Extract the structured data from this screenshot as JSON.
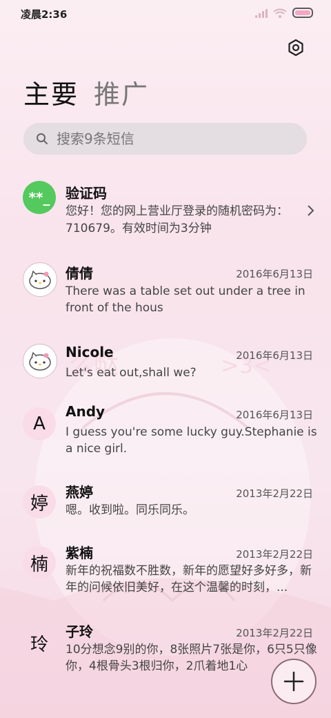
{
  "status_bar": {
    "time": "凌晨2:36"
  },
  "tabs": [
    {
      "label": "主要",
      "active": true
    },
    {
      "label": "推广",
      "active": false
    }
  ],
  "search": {
    "placeholder": "搜索9条短信"
  },
  "messages": [
    {
      "avatar_text": "**_",
      "name": "验证码",
      "date": "",
      "preview": "您好！您的网上营业厅登录的随机密码为：710679。有效时间为3分钟"
    },
    {
      "avatar_icon": "hello-kitty-icon",
      "name": "倩倩",
      "date": "2016年6月13日",
      "preview": "There was a table set out under a tree in front of the hous"
    },
    {
      "avatar_icon": "hello-kitty-icon",
      "name": "Nicole",
      "date": "2016年6月13日",
      "preview": "Let's eat out,shall we?"
    },
    {
      "avatar_text": "A",
      "name": "Andy",
      "date": "2016年6月13日",
      "preview": "I guess you're some lucky guy.Stephanie is a nice girl."
    },
    {
      "avatar_text": "婷",
      "name": "燕婷",
      "date": "2013年2月22日",
      "preview": "嗯。收到啦。同乐同乐。"
    },
    {
      "avatar_text": "楠",
      "name": "紫楠",
      "date": "2013年2月22日",
      "preview": "新年的祝福数不胜数，新年的愿望好多好多，新年的问候依旧美好，在这个温馨的时刻，..."
    },
    {
      "avatar_text": "玲",
      "name": "子玲",
      "date": "2013年2月22日",
      "preview": "10分想念9别的你，8张照片7张是你，6只5只像你，4根骨头3根归你，2爪着地1心"
    }
  ],
  "colors": {
    "accent_green": "#54c95d",
    "avatar_pink": "#f9dce8",
    "search_bg": "#e4dde1"
  }
}
